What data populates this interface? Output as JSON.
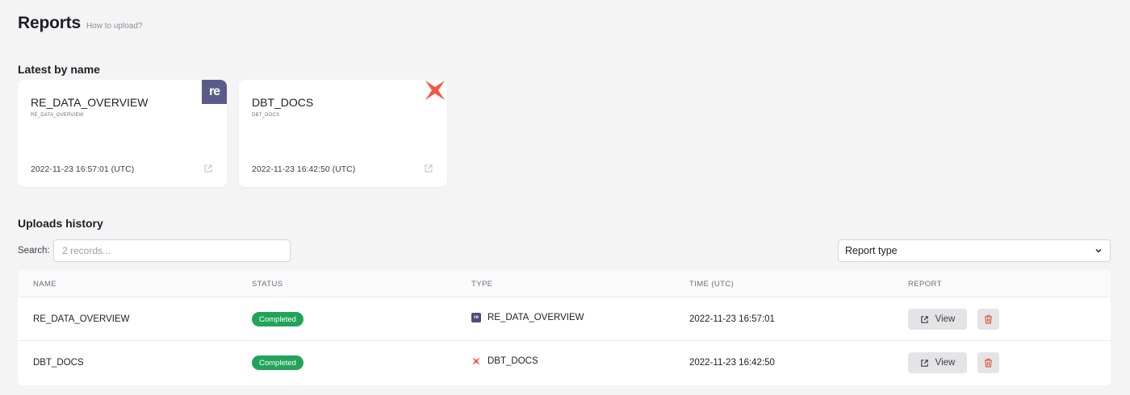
{
  "header": {
    "title": "Reports",
    "how_to_upload": "How to upload?"
  },
  "latest": {
    "section_title": "Latest by name",
    "cards": [
      {
        "name": "RE_DATA_OVERVIEW",
        "subtitle": "RE_DATA_OVERVIEW",
        "time": "2022-11-23 16:57:01 (UTC)",
        "badge": "re"
      },
      {
        "name": "DBT_DOCS",
        "subtitle": "DBT_DOCS",
        "time": "2022-11-23 16:42:50 (UTC)",
        "badge_icon": "dbt-logo-icon"
      }
    ]
  },
  "history": {
    "section_title": "Uploads history",
    "search": {
      "label": "Search:",
      "placeholder": "2 records..."
    },
    "filter": {
      "selected": "Report type"
    },
    "columns": [
      "NAME",
      "STATUS",
      "TYPE",
      "TIME (UTC)",
      "REPORT"
    ],
    "rows": [
      {
        "name": "RE_DATA_OVERVIEW",
        "status": "Completed",
        "type": "RE_DATA_OVERVIEW",
        "type_icon": "re-data-icon",
        "time": "2022-11-23 16:57:01",
        "view_label": "View"
      },
      {
        "name": "DBT_DOCS",
        "status": "Completed",
        "type": "DBT_DOCS",
        "type_icon": "dbt-icon",
        "time": "2022-11-23 16:42:50",
        "view_label": "View"
      }
    ]
  },
  "colors": {
    "status_completed": "#22a35a",
    "re_brand": "#5b5b8a",
    "dbt_brand": "#f05a3f",
    "delete_icon": "#e05c4b"
  }
}
